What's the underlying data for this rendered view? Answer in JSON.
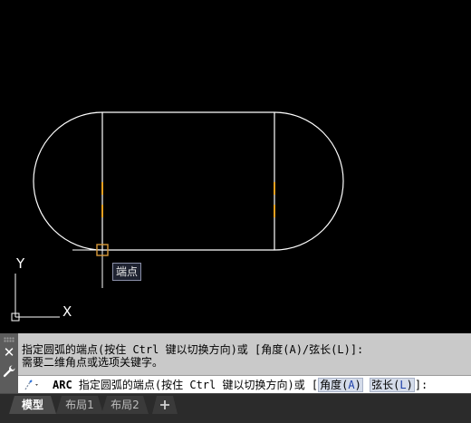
{
  "tooltip": {
    "text": "端点"
  },
  "ucs": {
    "y_label": "Y",
    "x_label": "X"
  },
  "command": {
    "history": [
      "指定圆弧的端点(按住 Ctrl 键以切换方向)或 [角度(A)/弦长(L)]:",
      "需要二维角点或选项关键字。"
    ],
    "prompt_keyword": "ARC",
    "prompt_text": " 指定圆弧的端点(按住 Ctrl 键以切换方向)或 [",
    "options": [
      {
        "label": "角度(",
        "key": "A",
        "close": ")"
      },
      {
        "label": "弦长(",
        "key": "L",
        "close": ")"
      }
    ],
    "prompt_end": "]:"
  },
  "tabs": [
    {
      "label": "模型",
      "active": true
    },
    {
      "label": "布局1",
      "active": false
    },
    {
      "label": "布局2",
      "active": false
    }
  ],
  "colors": {
    "background": "#000000",
    "geometry": "#ffffff",
    "snap_marker": "#e8a020",
    "osnap_box": "#d99a3a"
  }
}
